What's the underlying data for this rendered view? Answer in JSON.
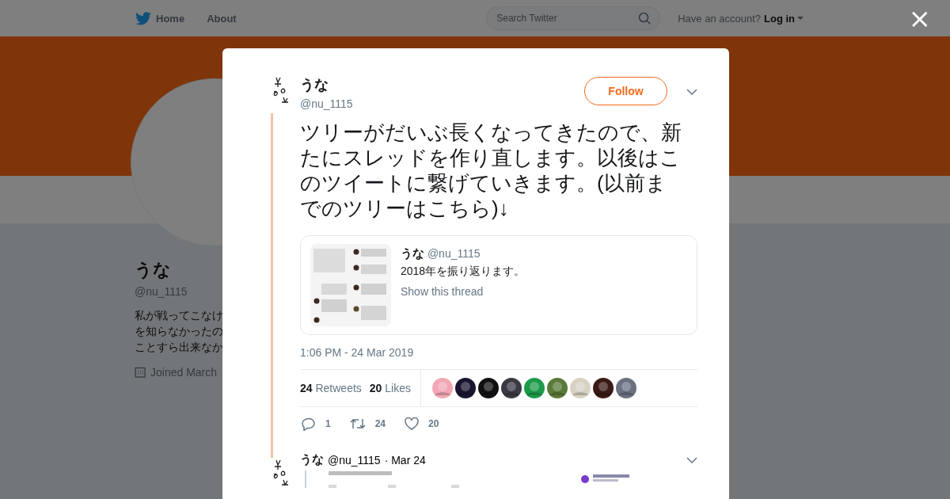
{
  "nav": {
    "items": [
      {
        "label": "Home",
        "kind": "home"
      },
      {
        "label": "About",
        "kind": "plain"
      }
    ],
    "search": {
      "placeholder": "Search Twitter"
    },
    "account_prompt": "Have an account?",
    "login": "Log in"
  },
  "profile": {
    "name": "うな",
    "handle": "@nu_1115",
    "bio_lines": [
      "私が戦ってこなけ",
      "を知らなかったの",
      "ことすら出来なか"
    ],
    "joined": "Joined March"
  },
  "close_label": "×",
  "tweet": {
    "name": "うな",
    "handle": "@nu_1115",
    "follow": "Follow",
    "text": "ツリーがだいぶ長くなってきたので、新たにスレッドを作り直します。以後はこのツイートに繋げていきます。(以前までのツリーはこちら)↓",
    "quote": {
      "name": "うな",
      "handle": "@nu_1115",
      "text": "2018年を振り返ります。",
      "link": "Show this thread"
    },
    "time": "1:06 PM - 24 Mar 2019",
    "stats": [
      {
        "count": "24",
        "label": "Retweets"
      },
      {
        "count": "20",
        "label": "Likes"
      }
    ],
    "actions": [
      {
        "kind": "reply",
        "count": "1"
      },
      {
        "kind": "retweet",
        "count": "24"
      },
      {
        "kind": "like",
        "count": "20"
      }
    ]
  },
  "reply": {
    "name": "うな",
    "handle": "@nu_1115",
    "date": "· Mar 24"
  }
}
